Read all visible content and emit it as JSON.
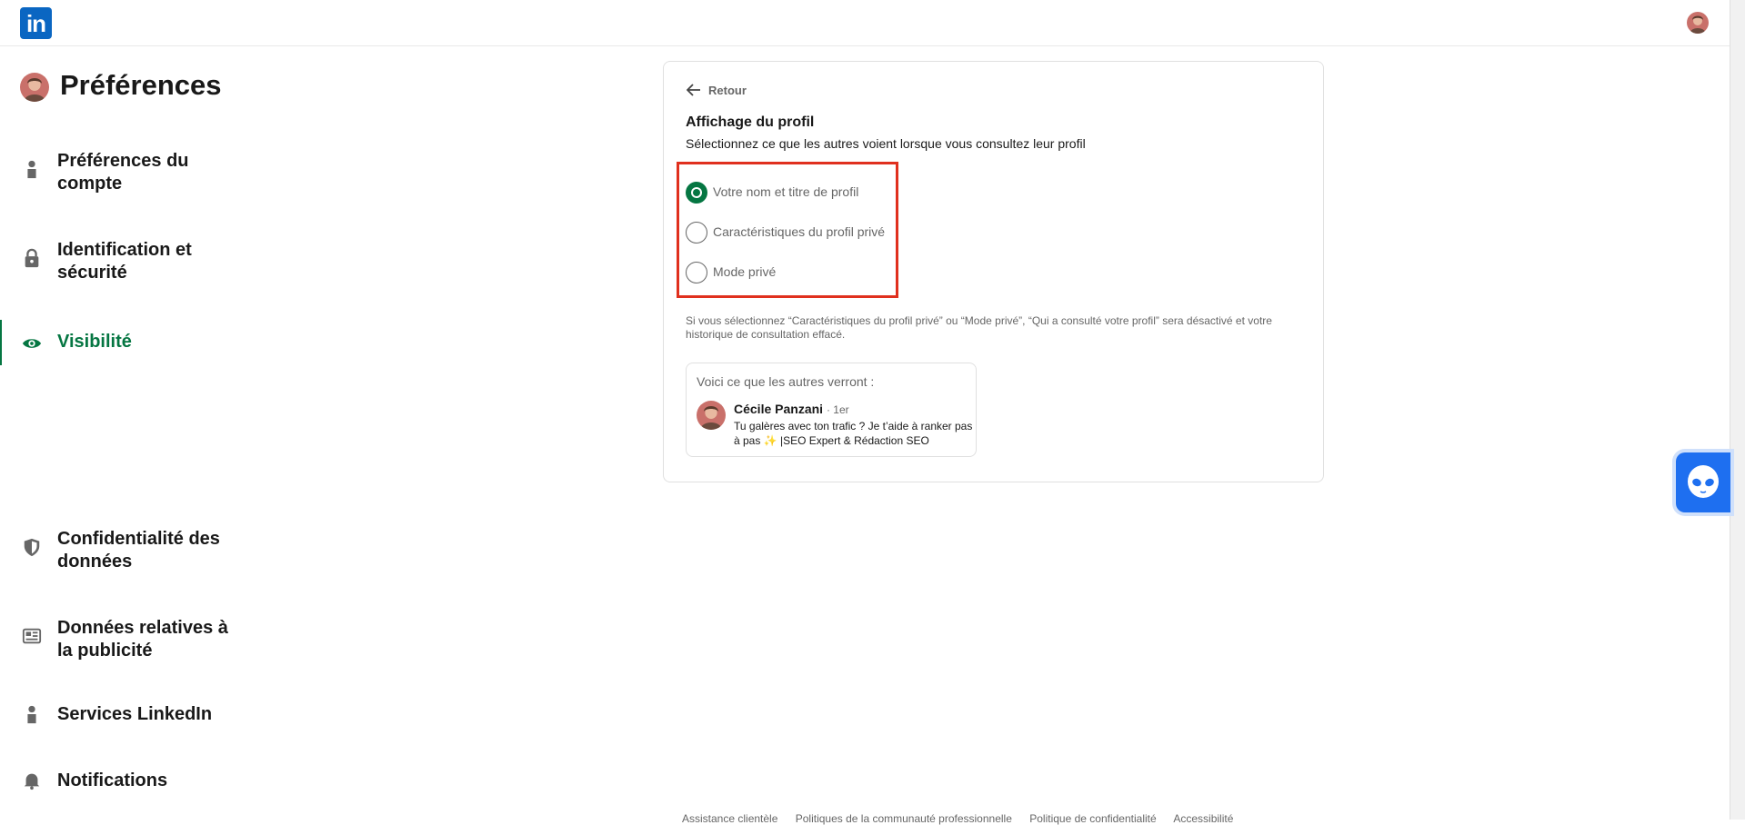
{
  "header": {
    "logo_text": "in",
    "avatar_icon": "user-avatar"
  },
  "sidebar": {
    "title": "Préférences",
    "items": [
      {
        "label": "Préférences du compte",
        "icon": "person-icon",
        "active": false
      },
      {
        "label": "Identification et sécurité",
        "icon": "lock-icon",
        "active": false
      },
      {
        "label": "Visibilité",
        "icon": "eye-icon",
        "active": true
      },
      {
        "label": "Confidentialité des données",
        "icon": "shield-icon",
        "active": false
      },
      {
        "label": "Données relatives à la publicité",
        "icon": "newspaper-icon",
        "active": false
      },
      {
        "label": "Services LinkedIn",
        "icon": "person-icon",
        "active": false
      },
      {
        "label": "Notifications",
        "icon": "bell-icon",
        "active": false
      }
    ]
  },
  "card": {
    "back_label": "Retour",
    "title": "Affichage du profil",
    "subtitle": "Sélectionnez ce que les autres voient lorsque vous consultez leur profil",
    "options": [
      {
        "label": "Votre nom et titre de profil",
        "selected": true
      },
      {
        "label": "Caractéristiques du profil privé",
        "selected": false
      },
      {
        "label": "Mode privé",
        "selected": false
      }
    ],
    "note": "Si vous sélectionnez “Caractéristiques du profil privé” ou “Mode privé”, “Qui a consulté votre profil” sera désactivé et votre historique de consultation effacé.",
    "preview": {
      "heading": "Voici ce que les autres verront :",
      "name": "Cécile Panzani",
      "degree": "· 1er",
      "headline": "Tu galères avec ton trafic ? Je t’aide à ranker pas à pas ✨ |SEO Expert & Rédaction SEO"
    }
  },
  "footer": {
    "links": [
      "Assistance clientèle",
      "Politiques de la communauté professionnelle",
      "Politique de confidentialité",
      "Accessibilité"
    ]
  },
  "colors": {
    "brand": "#0a66c2",
    "active_green": "#057642",
    "highlight_red": "#e0301e",
    "assistant_blue": "#1e6ff0"
  }
}
